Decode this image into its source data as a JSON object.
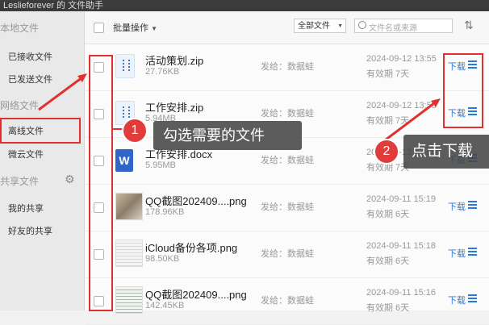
{
  "window": {
    "title": "Lesliefo​rever 的 文件助手"
  },
  "sidebar": {
    "local_files": "本地文件",
    "received": "已接收文件",
    "sent": "已发送文件",
    "network_files": "网络文件",
    "offline": "离线文件",
    "weiyun": "微云文件",
    "shared_files": "共享文件",
    "my_share": "我的共享",
    "friend_share": "好友的共享"
  },
  "toolbar": {
    "batch": "批量操作",
    "filter": "全部文件",
    "search_placeholder": "文件名或来源"
  },
  "files": [
    {
      "name": "活动策划.zip",
      "size": "27.76KB",
      "sender": "发给：数据蛙",
      "date": "2024-09-12 13:55",
      "validity": "有效期 7天",
      "icon": "zip"
    },
    {
      "name": "工作安排.zip",
      "size": "5.94MB",
      "sender": "发给：数据蛙",
      "date": "2024-09-12 13:55",
      "validity": "有效期 7天",
      "icon": "zip"
    },
    {
      "name": "工作安排.docx",
      "size": "5.95MB",
      "sender": "发给：数据蛙",
      "date": "2024-09-12 13:55",
      "validity": "有效期 7天",
      "icon": "word"
    },
    {
      "name": "QQ截图202409....png",
      "size": "178.96KB",
      "sender": "发给：数据蛙",
      "date": "2024-09-11 15:19",
      "validity": "有效期 6天",
      "icon": "image"
    },
    {
      "name": "iCloud备份各项.png",
      "size": "98.50KB",
      "sender": "发给：数据蛙",
      "date": "2024-09-11 15:18",
      "validity": "有效期 6天",
      "icon": "image"
    },
    {
      "name": "QQ截图202409....png",
      "size": "142.45KB",
      "sender": "发给：数据蛙",
      "date": "2024-09-11 15:16",
      "validity": "有效期 6天",
      "icon": "image"
    }
  ],
  "actions": {
    "download": "下载"
  },
  "annotations": {
    "step1_num": "1",
    "step1_text": "勾选需要的文件",
    "step2_num": "2",
    "step2_text": "点击下载"
  },
  "colors": {
    "accent": "#2b79d8",
    "highlight": "#e23030"
  }
}
